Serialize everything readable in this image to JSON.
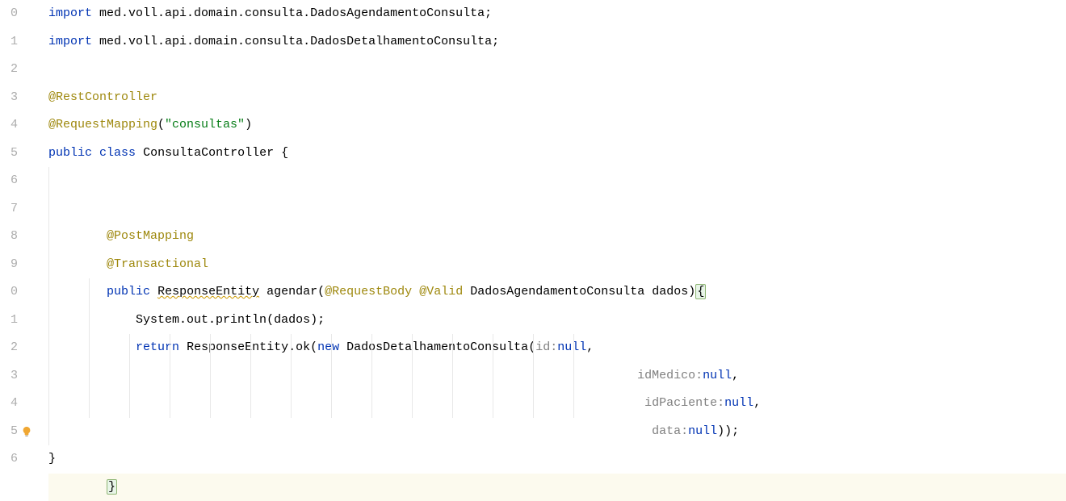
{
  "gutter": {
    "lines": [
      "0",
      "1",
      "2",
      "3",
      "4",
      "5",
      "6",
      "7",
      "8",
      "9",
      "0",
      "1",
      "2",
      "3",
      "4",
      "5",
      "6"
    ]
  },
  "code": {
    "kw_import": "import",
    "kw_public": "public",
    "kw_class": "class",
    "kw_return": "return",
    "kw_new": "new",
    "kw_null": "null",
    "pkg1": "med.voll.api.domain.consulta.DadosAgendamentoConsulta",
    "pkg2": "med.voll.api.domain.consulta.DadosDetalhamentoConsulta",
    "anno_rest": "@RestController",
    "anno_reqmap": "@RequestMapping",
    "anno_post": "@PostMapping",
    "anno_trans": "@Transactional",
    "anno_reqbody": "@RequestBody",
    "anno_valid": "@Valid",
    "str_consultas": "\"consultas\"",
    "class_name": "ConsultaController",
    "ret_type": "ResponseEntity",
    "method_name": "agendar",
    "param_type": "DadosAgendamentoConsulta",
    "param_name": "dados",
    "sys_out": "System.out.println",
    "arg_dados": "dados",
    "resp_ok": "ResponseEntity.ok",
    "dto_name": "DadosDetalhamentoConsulta",
    "hint_id": "id:",
    "hint_idMedico": "idMedico:",
    "hint_idPaciente": "idPaciente:",
    "hint_data": "data:"
  }
}
